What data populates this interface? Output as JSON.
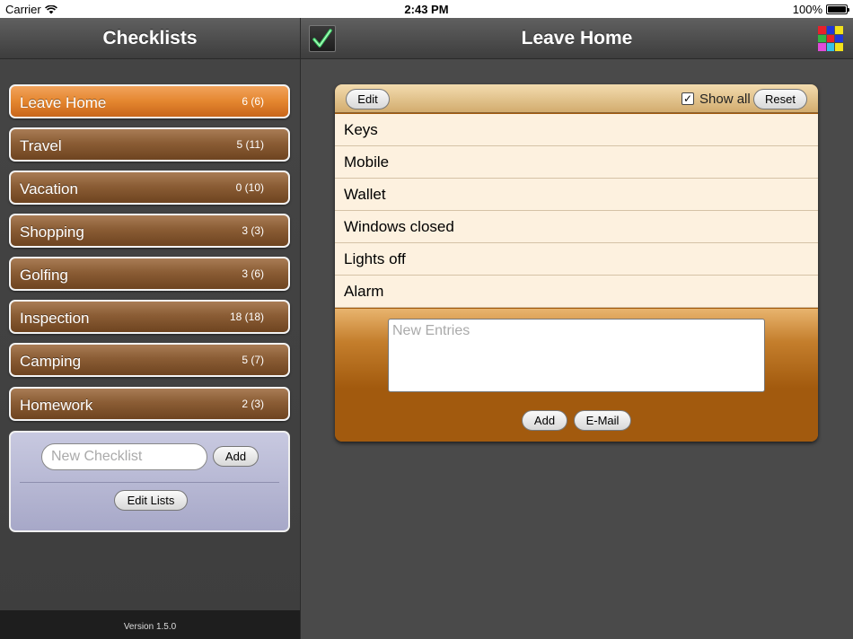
{
  "status": {
    "carrier": "Carrier",
    "time": "2:43 PM",
    "battery": "100%"
  },
  "sidebar": {
    "title": "Checklists",
    "lists": [
      {
        "name": "Leave Home",
        "count": "6 (6)",
        "active": true
      },
      {
        "name": "Travel",
        "count": "5 (11)"
      },
      {
        "name": "Vacation",
        "count": "0 (10)"
      },
      {
        "name": "Shopping",
        "count": "3 (3)"
      },
      {
        "name": "Golfing",
        "count": "3 (6)"
      },
      {
        "name": "Inspection",
        "count": "18 (18)"
      },
      {
        "name": "Camping",
        "count": "5 (7)"
      },
      {
        "name": "Homework",
        "count": "2 (3)"
      }
    ],
    "new_checklist_placeholder": "New Checklist",
    "add_label": "Add",
    "edit_lists_label": "Edit Lists",
    "version": "Version 1.5.0"
  },
  "main": {
    "title": "Leave Home",
    "edit_label": "Edit",
    "show_all_label": "Show all",
    "show_all_checked": true,
    "reset_label": "Reset",
    "items": [
      "Keys",
      "Mobile",
      "Wallet",
      "Windows closed",
      "Lights off",
      "Alarm"
    ],
    "new_entries_placeholder": "New Entries",
    "add_label": "Add",
    "email_label": "E-Mail"
  },
  "icons": {
    "checklist_logo": "checkmark-icon",
    "grid": "color-grid-icon",
    "grid_colors": [
      "#e8202a",
      "#2036d8",
      "#f2e21a",
      "#33b440",
      "#e8202a",
      "#2036d8",
      "#e04bd8",
      "#35c2e8",
      "#f2e21a"
    ]
  },
  "colors": {
    "active_list": "#e4862f",
    "list": "#8b5d35",
    "card": "#a25a0e"
  }
}
